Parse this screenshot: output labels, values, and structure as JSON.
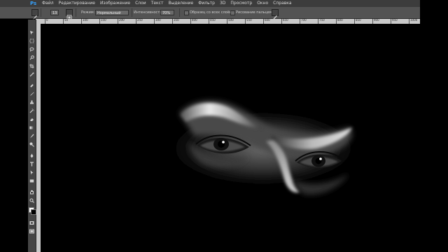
{
  "app": {
    "logo": "Ps"
  },
  "menu": [
    "Файл",
    "Редактирование",
    "Изображение",
    "Слои",
    "Текст",
    "Выделение",
    "Фильтр",
    "3D",
    "Просмотр",
    "Окно",
    "Справка"
  ],
  "options": {
    "brush_size": "13",
    "mode_label": "Режим:",
    "mode_value": "Нормальный",
    "intensity_label": "Интенсивность:",
    "intensity_value": "70%",
    "sample_all_layers": "Образец со всех слоёв",
    "finger_painting": "Рисование пальцем"
  },
  "ruler": [
    "0",
    "50",
    "100",
    "150",
    "200",
    "250",
    "300",
    "350",
    "400",
    "450",
    "500",
    "550",
    "600",
    "650",
    "700",
    "750",
    "800",
    "850",
    "900",
    "950",
    "1000"
  ],
  "tools": [
    "move-icon",
    "marquee-icon",
    "lasso-icon",
    "quick-select-icon",
    "crop-icon",
    "eyedropper-icon",
    "healing-brush-icon",
    "brush-icon",
    "clone-stamp-icon",
    "history-brush-icon",
    "eraser-icon",
    "gradient-icon",
    "smudge-icon",
    "dodge-icon",
    "pen-icon",
    "type-icon",
    "path-select-icon",
    "rectangle-icon",
    "hand-icon",
    "zoom-icon"
  ],
  "colors": {
    "foreground": "#ffffff",
    "background": "#000000",
    "accent": "#35a2ff"
  }
}
